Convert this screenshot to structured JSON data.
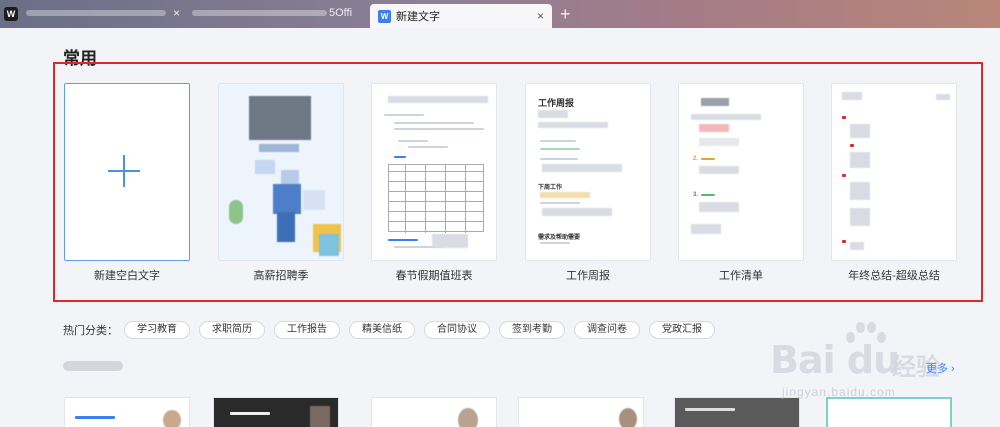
{
  "tabs": [
    {
      "label": "",
      "active": false
    },
    {
      "label": "5Offi",
      "active": false
    },
    {
      "label": "新建文字",
      "active": true
    }
  ],
  "app_logo": "W",
  "doc_icon": "W",
  "new_tab_symbol": "+",
  "close_symbol": "×",
  "section_title": "常用",
  "templates": [
    {
      "label": "新建空白文字"
    },
    {
      "label": "高薪招聘季"
    },
    {
      "label": "春节假期值班表"
    },
    {
      "label": "工作周报"
    },
    {
      "label": "工作清单"
    },
    {
      "label": "年终总结-超级总结"
    }
  ],
  "thumb_texts": {
    "weekly_title": "工作周报",
    "next_week": "下周工作",
    "help_needed": "需求及帮助需要"
  },
  "hot": {
    "label": "热门分类：",
    "chips": [
      "学习教育",
      "求职简历",
      "工作报告",
      "精美信纸",
      "合同协议",
      "签到考勤",
      "调查问卷",
      "党政汇报"
    ]
  },
  "more_label": "更多 ›",
  "watermark": {
    "brand": "Bai du",
    "cn": "经验",
    "url": "jingyan.baidu.com"
  },
  "colors": {
    "accent": "#3b7ff0",
    "highlight": "#e0262a"
  }
}
